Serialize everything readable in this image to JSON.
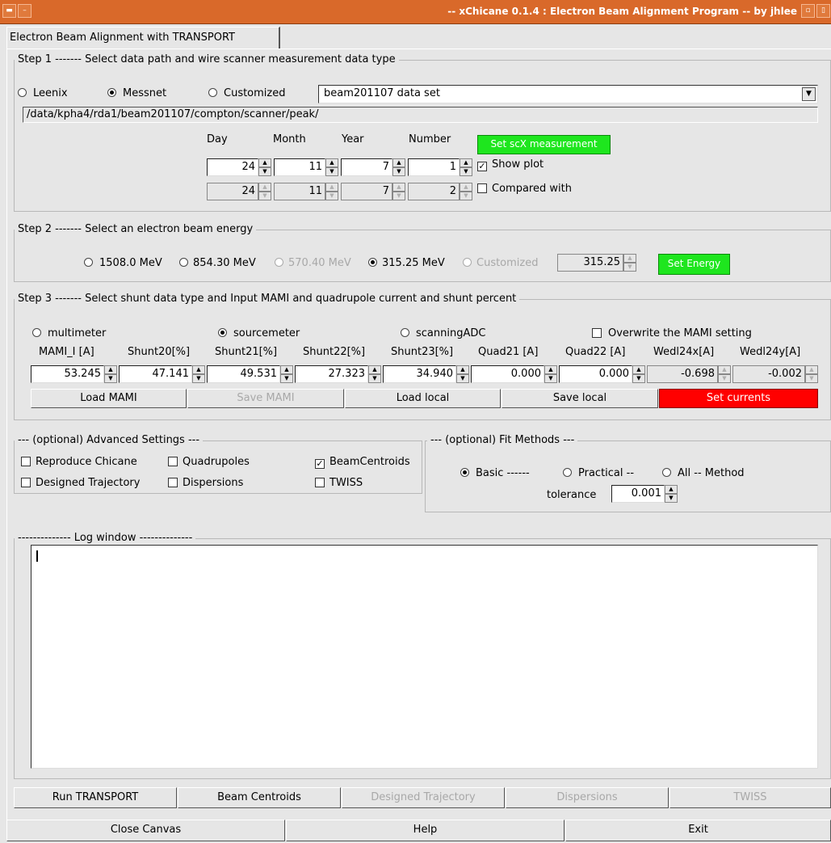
{
  "window": {
    "title": "-- xChicane 0.1.4 : Electron Beam Alignment Program -- by jhlee"
  },
  "tab": {
    "label": "Electron Beam Alignment with TRANSPORT"
  },
  "step1": {
    "legend": "Step 1 ------- Select data path and wire scanner measurement data type",
    "radios": [
      "Leenix",
      "Messnet",
      "Customized"
    ],
    "dataset": "beam201107 data set",
    "path": "/data/kpha4/rda1/beam201107/compton/scanner/peak/",
    "headers": [
      "Day",
      "Month",
      "Year",
      "Number"
    ],
    "row1": [
      "24",
      "11",
      "7",
      "1"
    ],
    "row2": [
      "24",
      "11",
      "7",
      "2"
    ],
    "set_button": "Set scX measurement",
    "show_plot": "Show plot",
    "compared_with": "Compared with"
  },
  "step2": {
    "legend": "Step 2 ------- Select an electron beam energy",
    "energies": [
      "1508.0 MeV",
      "854.30 MeV",
      "570.40 MeV",
      "315.25 MeV",
      "Customized"
    ],
    "energy_value": "315.25",
    "set_button": "Set Energy"
  },
  "step3": {
    "legend": "Step 3 ------- Select shunt data type and Input MAMI and quadrupole current and shunt percent",
    "radios": [
      "multimeter",
      "sourcemeter",
      "scanningADC"
    ],
    "overwrite": "Overwrite the MAMI setting",
    "headers": [
      "MAMI_I [A]",
      "Shunt20[%]",
      "Shunt21[%]",
      "Shunt22[%]",
      "Shunt23[%]",
      "Quad21 [A]",
      "Quad22 [A]",
      "Wedl24x[A]",
      "Wedl24y[A]"
    ],
    "values": [
      "53.245",
      "47.141",
      "49.531",
      "27.323",
      "34.940",
      "0.000",
      "0.000",
      "-0.698",
      "-0.002"
    ],
    "buttons": [
      "Load MAMI",
      "Save MAMI",
      "Load local",
      "Save local",
      "Set currents"
    ]
  },
  "advanced": {
    "legend": "--- (optional) Advanced Settings ---",
    "items": [
      "Reproduce Chicane",
      "Quadrupoles",
      "BeamCentroids",
      "Designed Trajectory",
      "Dispersions",
      "TWISS"
    ]
  },
  "fit": {
    "legend": "--- (optional) Fit Methods ---",
    "methods": [
      "Basic ------",
      "Practical --",
      "All -- Method"
    ],
    "tolerance_label": "tolerance",
    "tolerance_value": "0.001"
  },
  "log": {
    "legend": "-------------- Log window --------------"
  },
  "run_buttons": [
    "Run TRANSPORT",
    "Beam Centroids",
    "Designed Trajectory",
    "Dispersions",
    "TWISS"
  ],
  "bottom_buttons": [
    "Close Canvas",
    "Help",
    "Exit"
  ],
  "colors": {
    "titlebar": "#d9692a",
    "green_button": "#1ee61e",
    "red_button": "#ff0000",
    "background": "#e6e6e6"
  }
}
